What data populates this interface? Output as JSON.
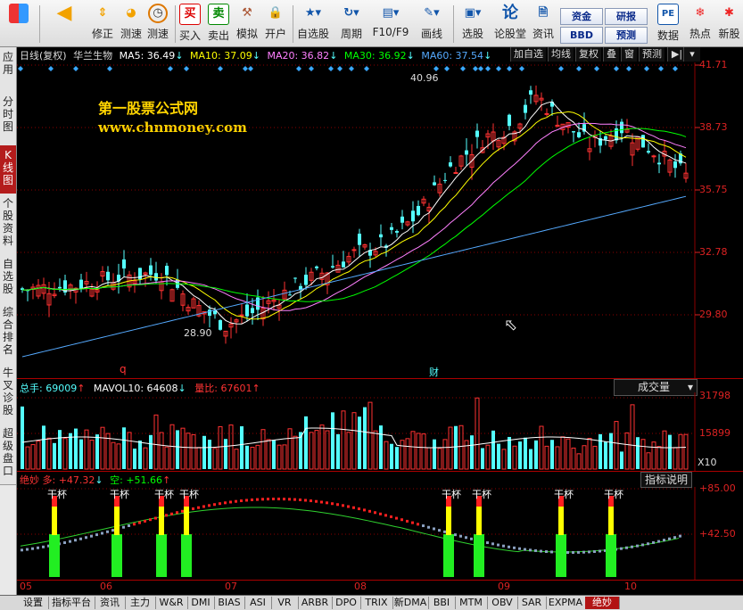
{
  "toolbar": {
    "buttons": [
      {
        "label": "",
        "icon": "grid-icon"
      },
      {
        "label": "",
        "icon": "back-arrow-icon"
      },
      {
        "label": "修正",
        "icon": "up-down-arrows-icon"
      },
      {
        "label": "测速",
        "icon": "speed-dial-icon"
      },
      {
        "label": "测速",
        "icon": "clock-icon"
      },
      {
        "label": "买入",
        "icon": "buy-icon",
        "glyph": "买"
      },
      {
        "label": "卖出",
        "icon": "sell-icon",
        "glyph": "卖"
      },
      {
        "label": "模拟",
        "icon": "hammer-icon"
      },
      {
        "label": "开户",
        "icon": "lock-icon"
      },
      {
        "label": "自选股",
        "icon": "star-icon"
      },
      {
        "label": "周期",
        "icon": "cycle-icon"
      },
      {
        "label": "F10/F9",
        "icon": "f10-icon"
      },
      {
        "label": "画线",
        "icon": "pen-icon"
      },
      {
        "label": "选股",
        "icon": "monitor-icon"
      },
      {
        "label": "论股堂",
        "icon": "forum-icon",
        "glyph": "论"
      },
      {
        "label": "资讯",
        "icon": "document-icon"
      },
      {
        "label": "数据",
        "icon": "pe-icon",
        "glyph": "PE"
      },
      {
        "label": "热点",
        "icon": "hot-icon"
      },
      {
        "label": "新股",
        "icon": "new-stock-icon"
      }
    ],
    "mini_buttons": [
      "资金",
      "BBD",
      "研报",
      "预测"
    ]
  },
  "sidebar": {
    "tabs": [
      "应用",
      "分时图",
      "K线图",
      "个股资料",
      "自选股",
      "综合排名",
      "牛叉诊股",
      "超级盘口"
    ],
    "active": 2
  },
  "header": {
    "period": "日线(复权)",
    "stock_name": "华兰生物",
    "ma5": "MA5: 36.49",
    "ma10": "MA10: 37.09",
    "ma20": "MA20: 36.82",
    "ma30": "MA30: 36.92",
    "ma60": "MA60: 37.54",
    "buttons": [
      "加自选",
      "均线",
      "复权",
      "叠",
      "窗",
      "预测"
    ]
  },
  "watermark": {
    "line1": "第一股票公式网",
    "line2": "www.chnmoney.com"
  },
  "price_axis": [
    "41.71",
    "38.73",
    "35.75",
    "32.78",
    "29.80"
  ],
  "annotations": {
    "high": "40.96",
    "low": "28.90",
    "marker_q": "q",
    "marker_cai": "财"
  },
  "volume_panel": {
    "total": "总手: 69009",
    "mavol": "MAVOL10: 64608",
    "ratio": "量比: 67601",
    "selector": "成交量",
    "axis": [
      "31798",
      "15899"
    ],
    "unit": "X10"
  },
  "indicator_panel": {
    "name": "绝妙",
    "long": "多: +47.32",
    "short": "空: +51.66",
    "explain_button": "指标说明",
    "axis": [
      "+85.00",
      "+42.50"
    ],
    "signal_label": "干杯",
    "signals_count": 9
  },
  "time_axis": [
    "05",
    "06",
    "07",
    "08",
    "09",
    "10"
  ],
  "bottom_tabs": [
    "设置",
    "指标平台",
    "资讯",
    "主力",
    "W&R",
    "DMI",
    "BIAS",
    "ASI",
    "VR",
    "ARBR",
    "DPO",
    "TRIX",
    "新DMA",
    "BBI",
    "MTM",
    "OBV",
    "SAR",
    "EXPMA",
    "绝妙"
  ],
  "bottom_active": 18,
  "colors": {
    "up": "#ff3232",
    "down": "#54ffff",
    "ma5": "#ffffff",
    "ma10": "#ffff00",
    "ma20": "#ff80ff",
    "ma30": "#00ff00",
    "ma60": "#55aaff",
    "grid": "#8b0000"
  }
}
